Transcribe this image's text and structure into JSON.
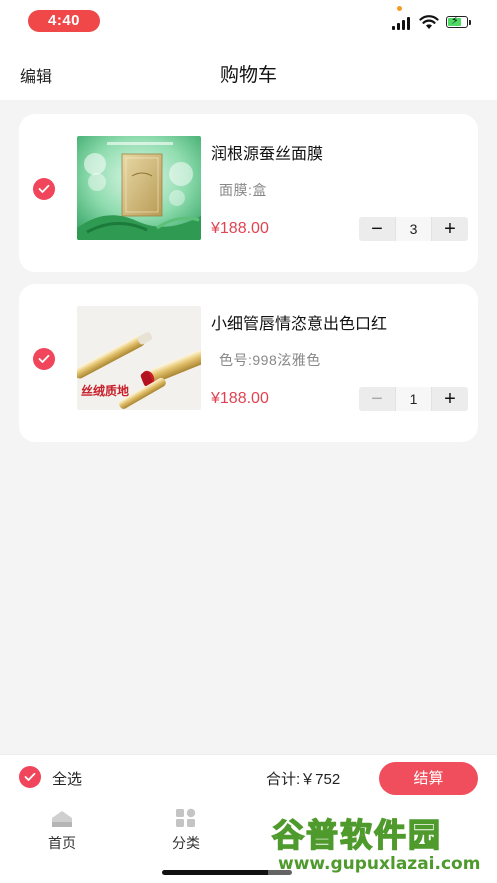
{
  "status_bar": {
    "time": "4:40"
  },
  "header": {
    "edit_label": "编辑",
    "title": "购物车"
  },
  "cart": {
    "items": [
      {
        "name": "润根源蚕丝面膜",
        "spec": "面膜:盒",
        "price": "¥188.00",
        "quantity": "3",
        "checked": true
      },
      {
        "name": "小细管唇情恣意出色口红",
        "spec": "色号:998泫雅色",
        "price": "¥188.00",
        "quantity": "1",
        "checked": true
      }
    ]
  },
  "stepper": {
    "minus": "−",
    "plus": "+"
  },
  "lipstick_image_text": "丝绒质地",
  "checkout": {
    "select_all_label": "全选",
    "total_text": "合计:￥752",
    "pay_label": "结算"
  },
  "tabbar": {
    "tabs": [
      {
        "label": "首页",
        "icon": "home-icon"
      },
      {
        "label": "分类",
        "icon": "category-icon"
      }
    ]
  },
  "watermark": {
    "title": "谷普软件园",
    "url": "www.gupuxlazai.com"
  },
  "colors": {
    "accent": "#f0455a",
    "price": "#e04452",
    "background": "#f4f4f4"
  }
}
